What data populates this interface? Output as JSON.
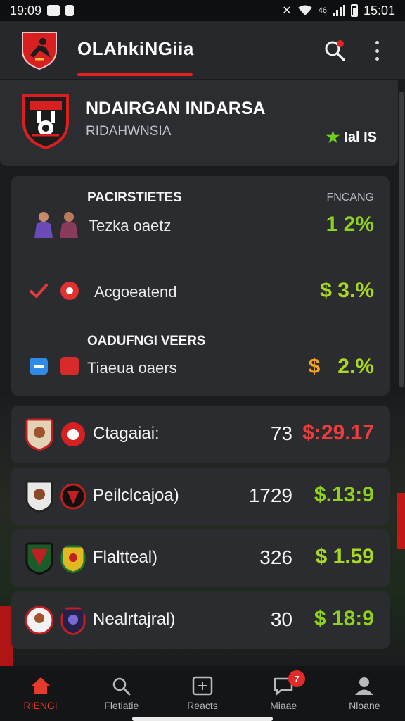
{
  "status_bar": {
    "time_left": "19:09",
    "network": "46",
    "time_right": "15:01"
  },
  "header": {
    "title": "OLAhkiNGiia"
  },
  "team": {
    "name": "NDAIRGAN INDARSA",
    "subtitle": "RIDAHWNSIA",
    "rating": "Ial IS"
  },
  "odds_panel": {
    "section1_title": "PACIRSTIETES",
    "column_header": "FNCANG",
    "rows": [
      {
        "label": "Tezka oaetz",
        "value": "1  2%"
      },
      {
        "label": "Acgoeatend",
        "value": "$  3.%"
      },
      {
        "label": "Tiaeua oaers",
        "value": "$  2.%"
      }
    ],
    "section2_title": "OADUFNGI VEERS"
  },
  "matches": [
    {
      "name": "Ctagaiai:",
      "count": "73",
      "price": "$:29.17",
      "price_color": "#ee3b3b"
    },
    {
      "name": "Peilclcajoa)",
      "count": "1729",
      "price": "$.13:9",
      "price_color": "#8ed21f"
    },
    {
      "name": "Flaltteal)",
      "count": "326",
      "price": "$  1.59",
      "price_color": "#a8d822"
    },
    {
      "name": "Nealrtajral)",
      "count": "30",
      "price": "$ 18:9",
      "price_color": "#8ed21f"
    }
  ],
  "bottom_nav": [
    {
      "label": "RIENGI",
      "icon": "home-icon",
      "active": true
    },
    {
      "label": "Fletiatie",
      "icon": "search-icon",
      "active": false
    },
    {
      "label": "Reacts",
      "icon": "scoreboard-icon",
      "active": false
    },
    {
      "label": "Miaae",
      "icon": "chat-icon",
      "active": false,
      "badge": "7"
    },
    {
      "label": "Nloane",
      "icon": "profile-icon",
      "active": false
    }
  ],
  "colors": {
    "accent_red": "#e32222",
    "odds_green": "#8ed21f",
    "background": "#1a1b1e",
    "card": "#2a2c30"
  }
}
